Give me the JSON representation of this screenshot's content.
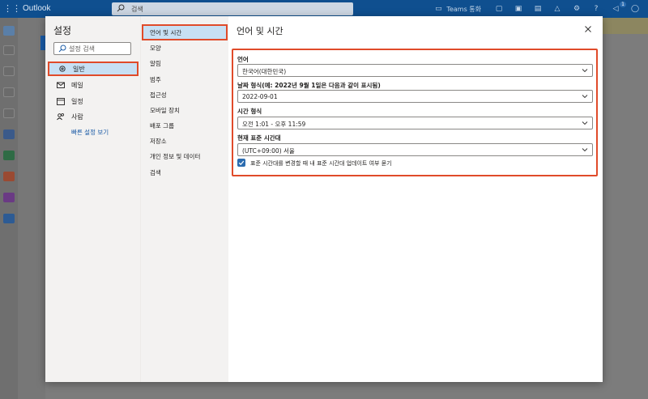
{
  "app": {
    "title": "Outlook",
    "search_placeholder": "검색",
    "teams_label": "Teams 통화",
    "notify_count": "1"
  },
  "settings": {
    "title": "설정",
    "search_placeholder": "설정 검색",
    "categories": [
      {
        "label": "일반",
        "icon": "gear-icon",
        "selected": true
      },
      {
        "label": "메일",
        "icon": "mail-icon"
      },
      {
        "label": "일정",
        "icon": "calendar-icon"
      },
      {
        "label": "사람",
        "icon": "people-icon"
      }
    ],
    "quick_settings_link": "빠른 설정 보기",
    "subcategories": [
      {
        "label": "언어 및 시간",
        "selected": true
      },
      {
        "label": "모양"
      },
      {
        "label": "알림"
      },
      {
        "label": "범주"
      },
      {
        "label": "접근성"
      },
      {
        "label": "모바일 장치"
      },
      {
        "label": "배포 그룹"
      },
      {
        "label": "저장소"
      },
      {
        "label": "개인 정보 및 데이터"
      },
      {
        "label": "검색"
      }
    ]
  },
  "pane": {
    "title": "언어 및 시간",
    "fields": [
      {
        "label": "언어",
        "value": "한국어(대한민국)"
      },
      {
        "label": "날짜 형식(예: 2022년 9월 1일은 다음과 같이 표시됨)",
        "value": "2022-09-01"
      },
      {
        "label": "시간 형식",
        "value": "오전 1:01 - 오후 11:59"
      },
      {
        "label": "현재 표준 시간대",
        "value": "(UTC+09:00) 서울"
      }
    ],
    "checkbox_label": "표준 시간대를 변경할 때 내 표준 시간대 업데이트 여부 묻기",
    "checkbox_checked": true
  },
  "colors": {
    "accent": "#2b6cb0",
    "highlight_border": "#e04b2a",
    "selected_bg": "#c7e0f4",
    "topbar": "#0f4f8f"
  }
}
